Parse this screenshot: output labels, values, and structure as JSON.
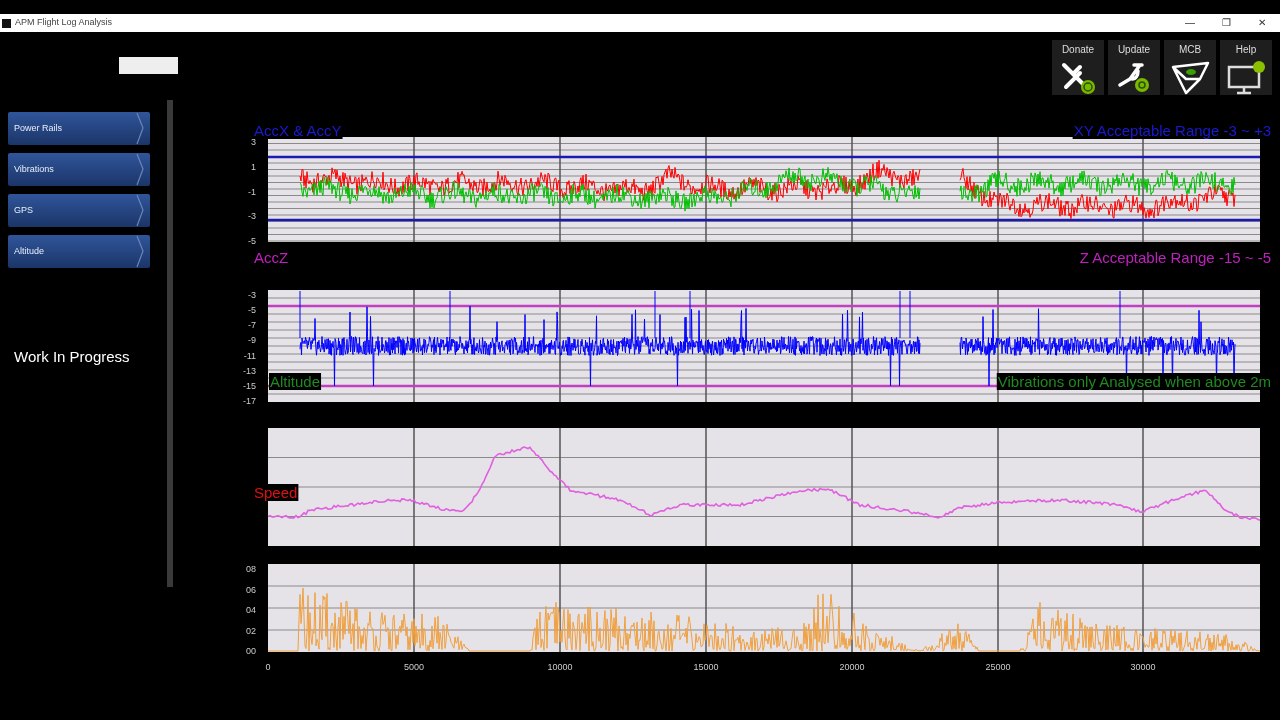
{
  "window": {
    "title": "APM Flight Log Analysis",
    "controls": [
      "—",
      "❐",
      "✕"
    ]
  },
  "sidebar": {
    "items": [
      {
        "label": "Power Rails"
      },
      {
        "label": "Vibrations"
      },
      {
        "label": "GPS"
      },
      {
        "label": "Altitude"
      }
    ],
    "note": "Work In Progress"
  },
  "toolbar": [
    {
      "label": "Donate",
      "kind": "donate"
    },
    {
      "label": "Update",
      "kind": "update"
    },
    {
      "label": "MCB",
      "kind": "mcb"
    },
    {
      "label": "Help",
      "kind": "help"
    }
  ],
  "charts": [
    {
      "kind": "accel_xy",
      "title": "AccX & AccY",
      "range_label": "XY Acceptable Range -3 ~ +3",
      "yticks": [
        "3",
        "1",
        "-1",
        "-3",
        "-5"
      ],
      "traces": [
        {
          "color": "#ff0000"
        },
        {
          "color": "#00c000"
        }
      ]
    },
    {
      "kind": "accel_z",
      "title": "AccZ",
      "range_label": "Z Acceptable Range -15 ~ -5",
      "yticks": [
        "-3",
        "-5",
        "-7",
        "-9",
        "-11",
        "-13",
        "-15",
        "-17"
      ],
      "traces": [
        {
          "color": "#0000ff"
        }
      ]
    },
    {
      "kind": "altitude",
      "title": "Altitude",
      "range_label": "Vibrations only Analysed when above 2m",
      "traces": [
        {
          "color": "#e060e0"
        }
      ]
    },
    {
      "kind": "speed",
      "title": "Speed",
      "yticks": [
        "08",
        "06",
        "04",
        "02",
        "00"
      ],
      "traces": [
        {
          "color": "#f0a040"
        }
      ],
      "xticks": [
        "0",
        "5000",
        "10000",
        "15000",
        "20000",
        "25000",
        "30000"
      ]
    }
  ]
}
